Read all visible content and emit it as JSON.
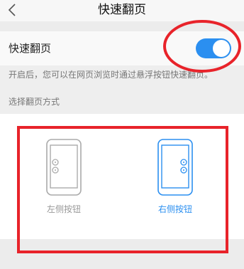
{
  "header": {
    "back_icon": "chevron-left-icon",
    "title": "快速翻页"
  },
  "toggle_row": {
    "label": "快速翻页",
    "enabled": true,
    "toggle_color": "#2b8ff0"
  },
  "description": {
    "text": "开启后，您可以在网页浏览时通过悬浮按钮快速翻页。",
    "mode_label": "选择翻页方式"
  },
  "options": [
    {
      "label": "左侧按钮",
      "selected": false,
      "icon": "phone-left-buttons-icon",
      "color": "#aaaaaa"
    },
    {
      "label": "右侧按钮",
      "selected": true,
      "icon": "phone-right-buttons-icon",
      "color": "#2b8ff0"
    }
  ],
  "annotations": {
    "color": "#e8232a"
  }
}
